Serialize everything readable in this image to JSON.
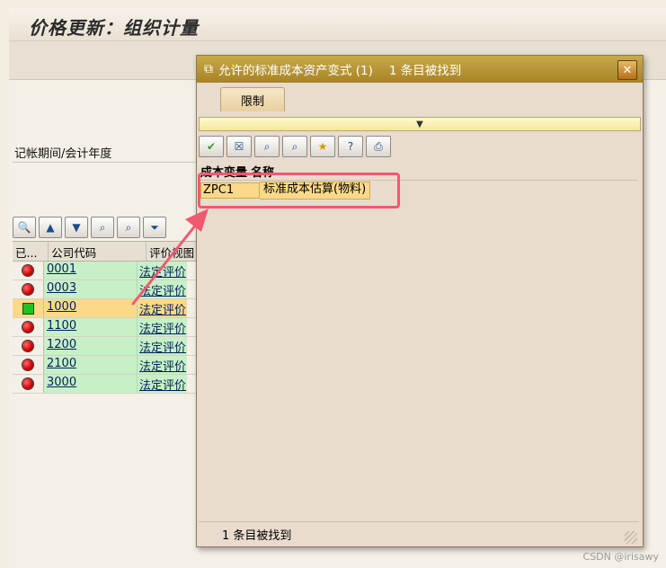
{
  "screen": {
    "title": "价格更新：组织计量",
    "period_label": "记帐期间/会计年度"
  },
  "grid": {
    "headers": {
      "status": "已...",
      "company_code": "公司代码",
      "valuation_view": "评价视图"
    },
    "rows": [
      {
        "status": "red",
        "company_code": "0001",
        "valuation_view": "法定评价"
      },
      {
        "status": "red",
        "company_code": "0003",
        "valuation_view": "法定评价"
      },
      {
        "status": "green",
        "company_code": "1000",
        "valuation_view": "法定评价"
      },
      {
        "status": "red",
        "company_code": "1100",
        "valuation_view": "法定评价"
      },
      {
        "status": "red",
        "company_code": "1200",
        "valuation_view": "法定评价"
      },
      {
        "status": "red",
        "company_code": "2100",
        "valuation_view": "法定评价"
      },
      {
        "status": "red",
        "company_code": "3000",
        "valuation_view": "法定评价"
      }
    ]
  },
  "popup": {
    "title": "允许的标准成本资产变式 (1)",
    "count": "1 条目被找到",
    "close_label": "✕",
    "tab_label": "限制",
    "columns": {
      "variant": "成本变量",
      "name": "名称"
    },
    "rows": [
      {
        "variant": "ZPC1",
        "name": "标准成本估算(物料)"
      }
    ],
    "status_text": "1 条目被找到"
  },
  "watermark": "CSDN @irisawy",
  "colors": {
    "popup_title": "#b8942f",
    "selected_row": "#fbd98a",
    "green_cell": "#c7f0c7",
    "highlight": "#f2596f"
  }
}
